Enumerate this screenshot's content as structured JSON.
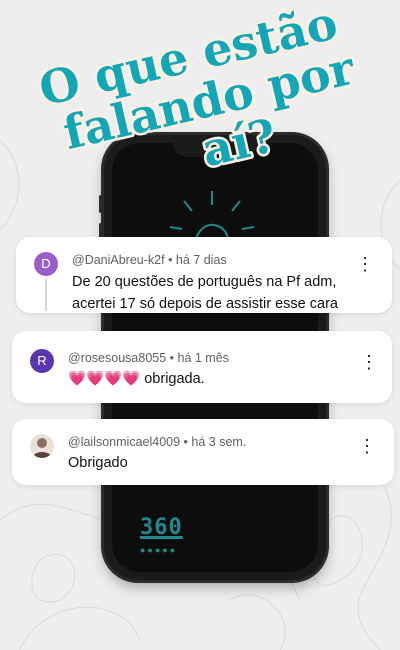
{
  "headline": {
    "line1": "O que estão",
    "line2": "falando por",
    "line3": "aí?"
  },
  "colors": {
    "headline_fill": "#12a7b6",
    "headline_stroke": "#fdf0e2",
    "brand_teal": "#1e8a8f"
  },
  "phone": {
    "logo": "360",
    "logo_dots": "●●●●●"
  },
  "comments": [
    {
      "avatar_letter": "D",
      "avatar_color": "#9b5ec9",
      "username": "@DaniAbreu-k2f",
      "time": "há 7 dias",
      "text_line1": "De 20 questões de português na Pf adm,",
      "text_line2": "acertei 17 só depois de assistir esse cara",
      "menu_icon": "more-vert-icon"
    },
    {
      "avatar_letter": "R",
      "avatar_color": "#5e35b1",
      "username": "@rosesousa8055",
      "time": "há 1 mês",
      "hearts": "💗💗💗💗",
      "text": " obrigada.",
      "menu_icon": "more-vert-icon"
    },
    {
      "avatar_letter": "",
      "avatar_color": "#8d6e63",
      "username": "@lailsonmicael4009",
      "time": "há 3 sem.",
      "text": "Obrigado",
      "menu_icon": "more-vert-icon"
    }
  ],
  "meta_separator": " • "
}
